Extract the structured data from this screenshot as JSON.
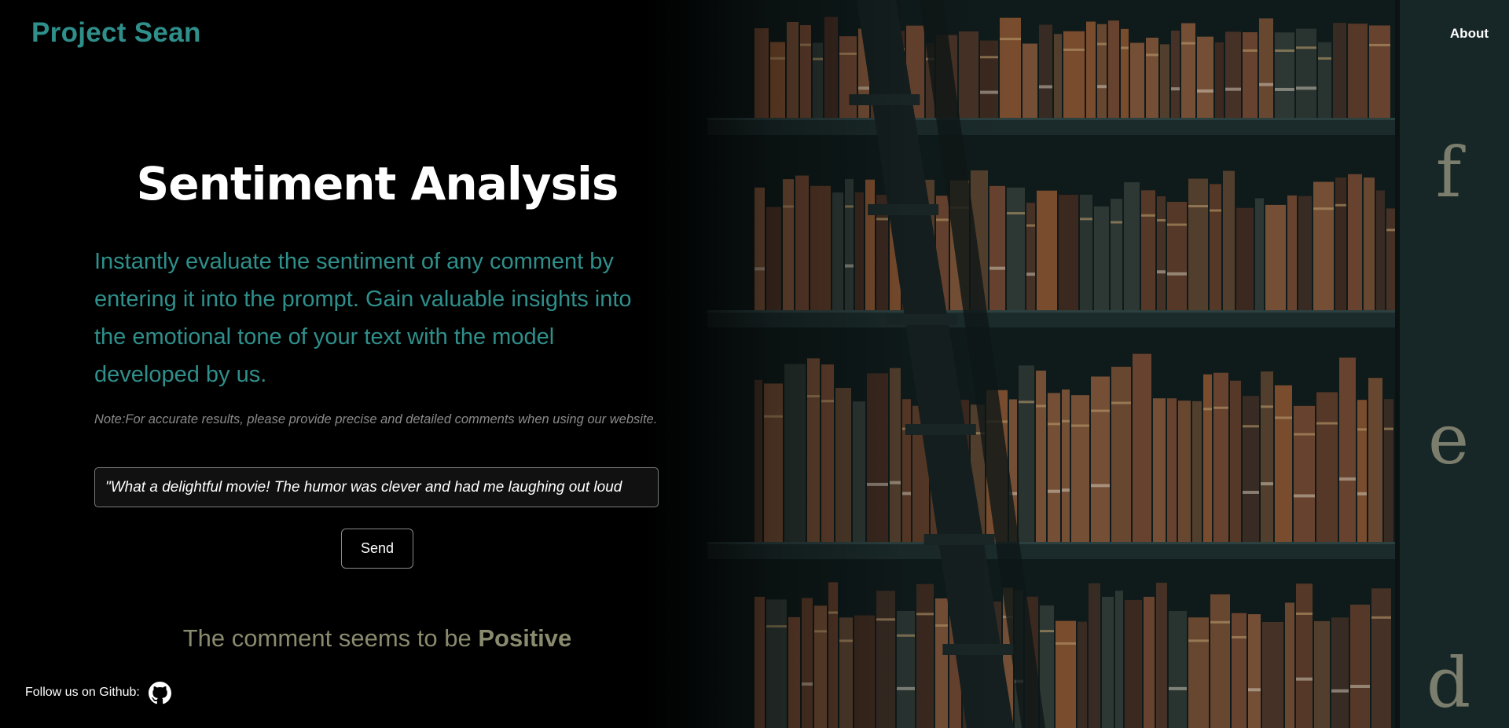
{
  "header": {
    "brand": "Project Sean",
    "nav_about": "About"
  },
  "main": {
    "title": "Sentiment Analysis",
    "description": "Instantly evaluate the sentiment of any comment by entering it into the prompt. Gain valuable insights into the emotional tone of your text with the model developed by us.",
    "note": "Note:For accurate results, please provide precise and detailed comments when using our website.",
    "comment_input_value": "\"What a delightful movie! The humor was clever and had me laughing out loud",
    "send_label": "Send",
    "result_prefix": "The comment seems to be",
    "result_value": "Positive"
  },
  "footer": {
    "follow_label": "Follow us on Github:",
    "github_icon": "github-icon"
  },
  "background": {
    "spine_letters": [
      "f",
      "e",
      "d"
    ]
  },
  "colors": {
    "brand": "#2f8f8b",
    "description": "#2f8f8b",
    "result": "#8a8a6e",
    "note": "#8a8a8a"
  }
}
